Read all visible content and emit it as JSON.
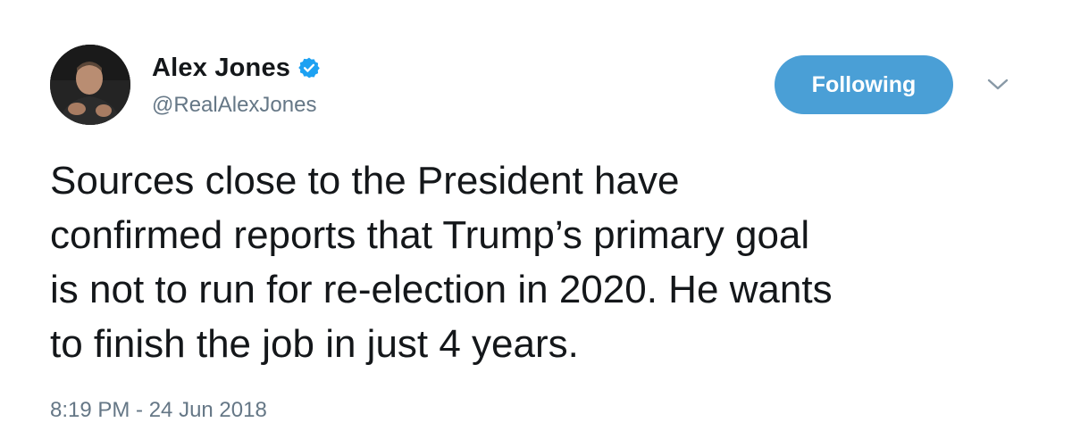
{
  "user": {
    "display_name": "Alex Jones",
    "handle": "@RealAlexJones",
    "verified": true,
    "avatar_icon": "profile-photo"
  },
  "follow_button": {
    "label": "Following"
  },
  "menu": {
    "icon": "chevron-down-icon"
  },
  "tweet": {
    "lines": [
      "Sources close to the President have",
      "confirmed reports that Trump’s primary goal",
      "is not to run for re-election in 2020. He wants",
      "to finish the job in just 4 years."
    ],
    "timestamp": "8:19 PM - 24 Jun 2018"
  },
  "colors": {
    "follow_button_bg": "#4a9fd6",
    "verified_badge": "#1da1f2",
    "secondary_text": "#657786",
    "primary_text": "#14171a"
  }
}
